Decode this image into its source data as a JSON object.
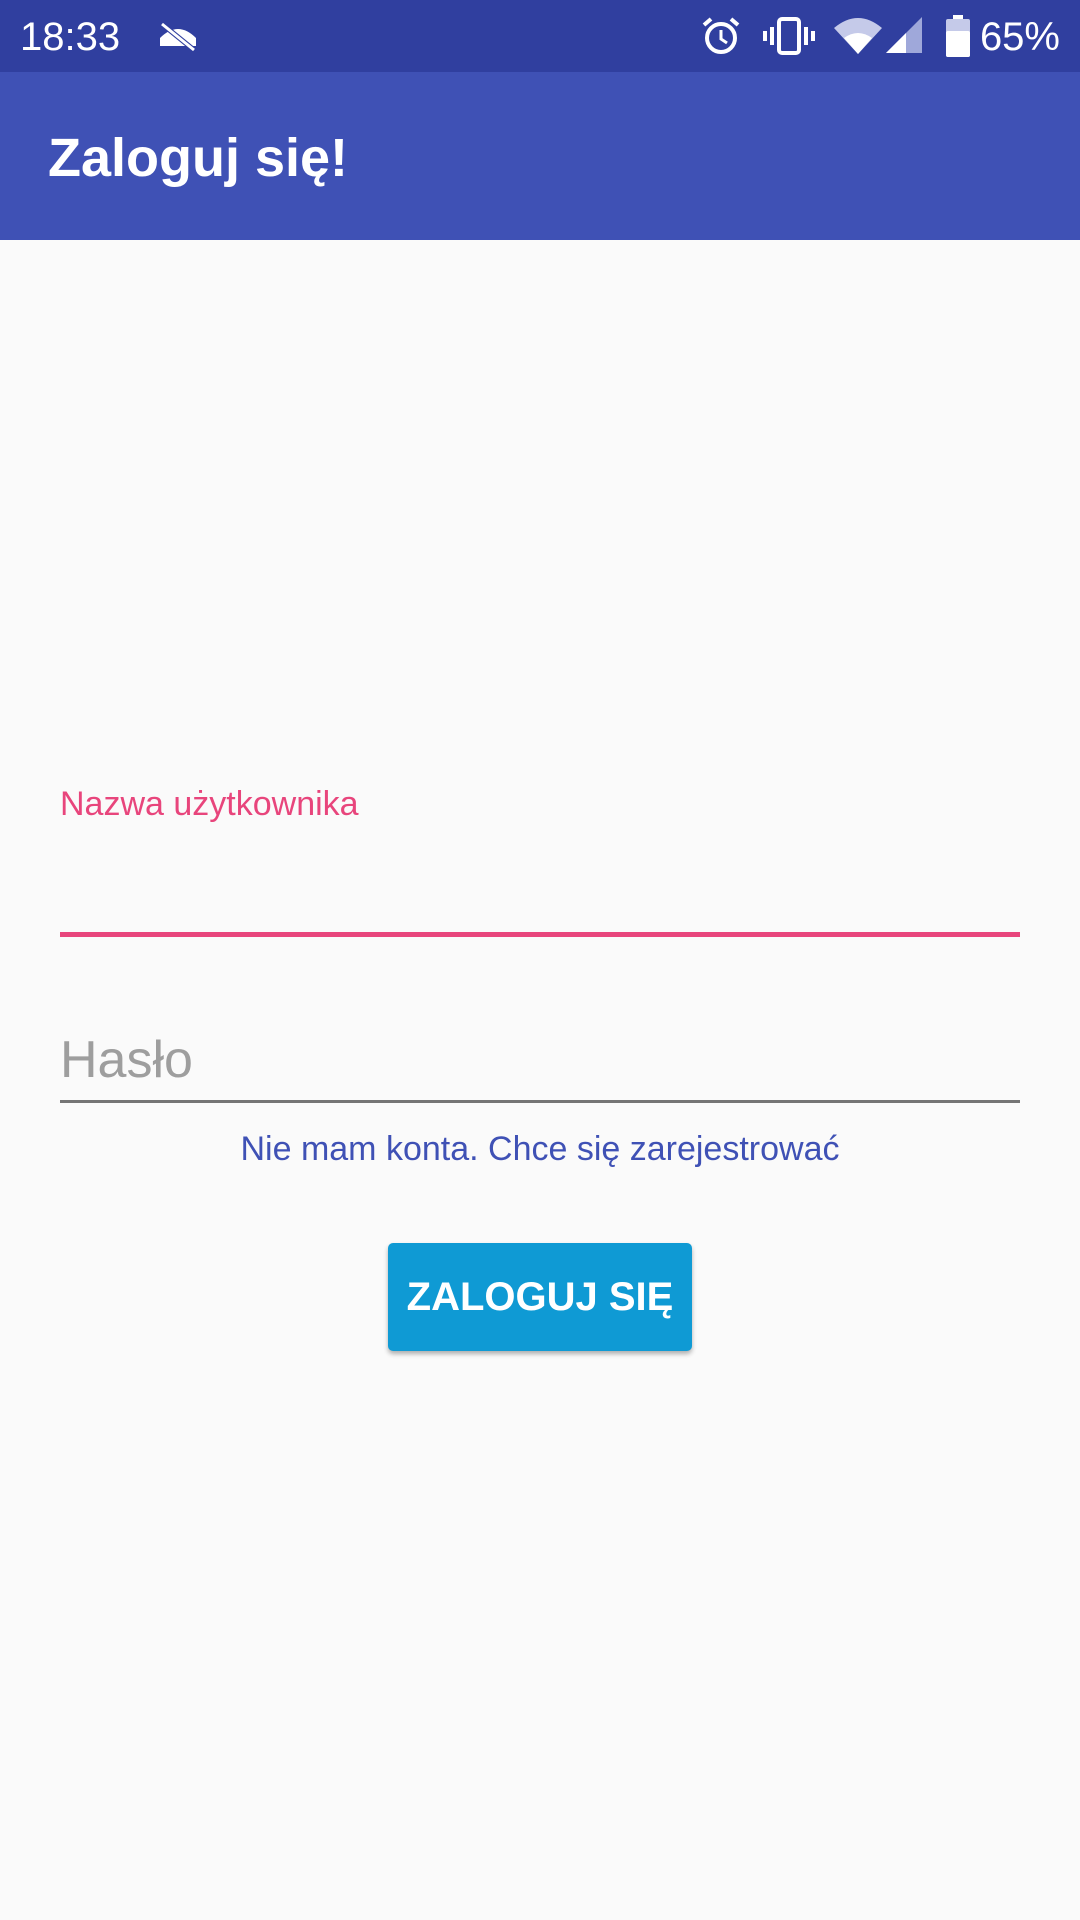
{
  "status_bar": {
    "time": "18:33",
    "battery_percent": "65%",
    "battery_level": 0.65,
    "icons": [
      "screen-share-off-icon",
      "alarm-clock-icon",
      "vibrate-icon",
      "wifi-icon",
      "cell-signal-icon",
      "battery-icon"
    ]
  },
  "app_bar": {
    "title": "Zaloguj się!"
  },
  "form": {
    "username": {
      "label": "Nazwa użytkownika",
      "value": ""
    },
    "password": {
      "placeholder": "Hasło",
      "value": ""
    },
    "register_link": "Nie mam konta. Chce się zarejestrować",
    "login_button": "ZALOGUJ SIĘ"
  },
  "colors": {
    "status_bar": "#303f9f",
    "app_bar": "#3f51b5",
    "accent": "#e8457c",
    "button": "#0f9ad4",
    "background": "#fafafa"
  }
}
